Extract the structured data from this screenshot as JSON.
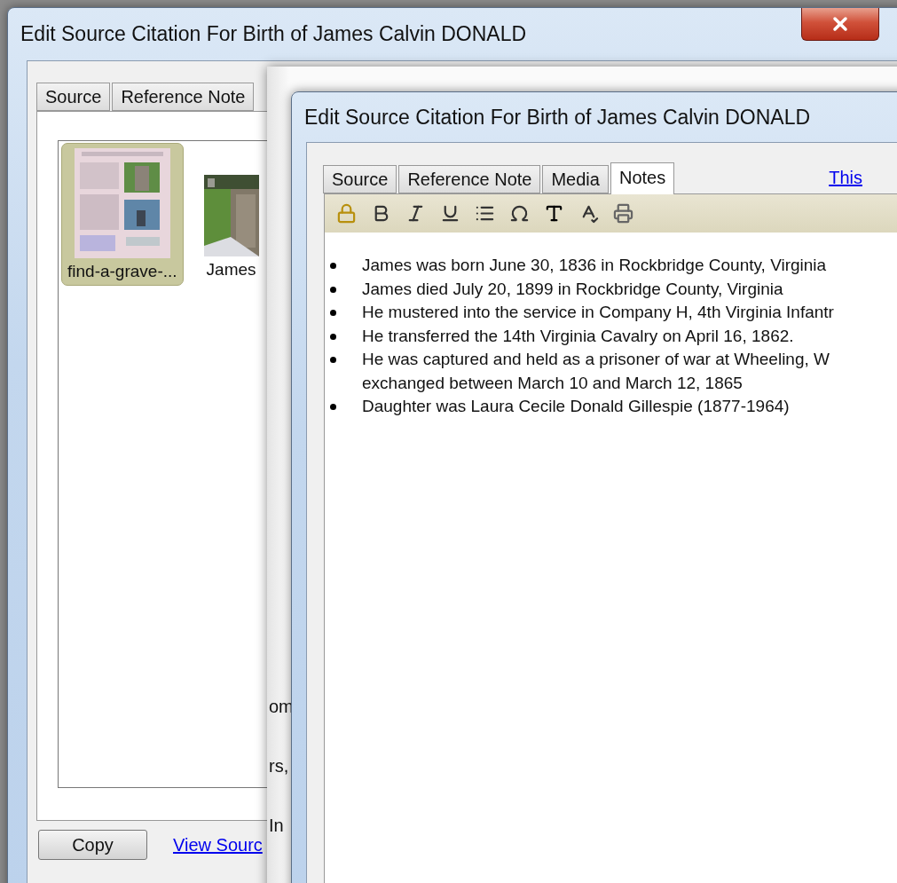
{
  "back_window": {
    "title": "Edit Source Citation For Birth of James Calvin DONALD",
    "tabs": [
      {
        "label": "Source",
        "selected": false
      },
      {
        "label": "Reference Note",
        "selected": false
      }
    ],
    "media": [
      {
        "kind": "page",
        "caption": "find-a-grave-...",
        "selected": true
      },
      {
        "caption": "James",
        "selected": false
      }
    ],
    "button": "Copy",
    "link": "View Sourc"
  },
  "middle_window": {
    "fragments": [
      "om",
      "rs,",
      "In"
    ]
  },
  "front_window": {
    "title": "Edit Source Citation For Birth of James Calvin DONALD",
    "tabs": [
      {
        "label": "Source",
        "selected": false
      },
      {
        "label": "Reference Note",
        "selected": false
      },
      {
        "label": "Media",
        "selected": false
      },
      {
        "label": "Notes",
        "selected": true
      }
    ],
    "link": "This",
    "toolbar": [
      {
        "kind": "lock"
      },
      {
        "kind": "bold"
      },
      {
        "kind": "italic"
      },
      {
        "kind": "underline"
      },
      {
        "kind": "list"
      },
      {
        "kind": "symbol"
      },
      {
        "kind": "font-color"
      },
      {
        "kind": "spellcheck"
      },
      {
        "kind": "print"
      }
    ],
    "notes": [
      {
        "lines": [
          "James was born June 30, 1836 in Rockbridge County, Virginia"
        ]
      },
      {
        "lines": [
          "James died July 20, 1899 in Rockbridge County, Virginia"
        ]
      },
      {
        "lines": [
          "He mustered into the service in Company H, 4th Virginia Infantr"
        ]
      },
      {
        "lines": [
          "He transferred the 14th Virginia Cavalry on April 16, 1862."
        ]
      },
      {
        "lines": [
          "He was captured and held as a prisoner of war at Wheeling, W",
          "exchanged between March 10 and March 12, 1865"
        ]
      },
      {
        "lines": [
          "Daughter was Laura Cecile Donald Gillespie (1877-1964)"
        ]
      }
    ]
  }
}
